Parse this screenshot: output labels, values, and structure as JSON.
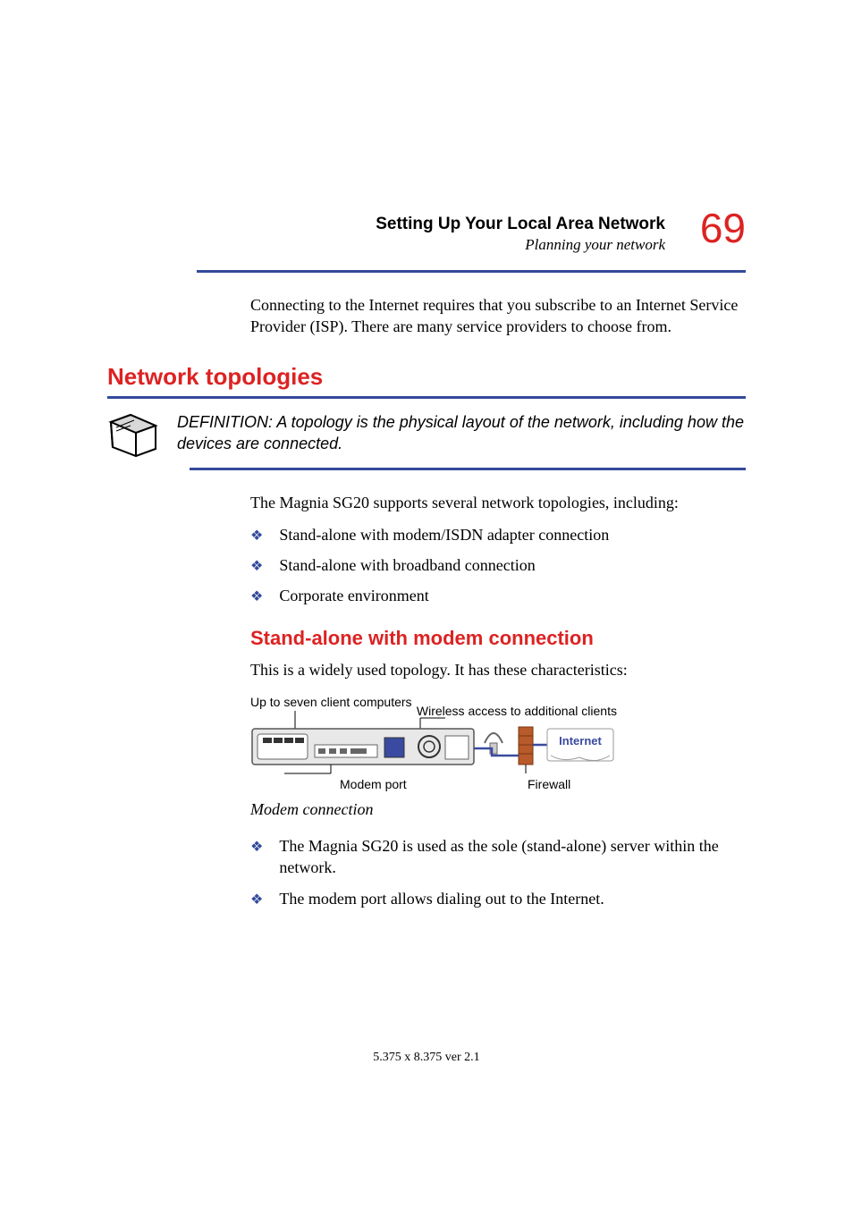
{
  "header": {
    "title": "Setting Up Your Local Area Network",
    "subtitle": "Planning your network",
    "page_number": "69"
  },
  "intro_para": "Connecting to the Internet requires that you subscribe to an Internet Service Provider (ISP). There are many service providers to choose from.",
  "h1": "Network topologies",
  "definition": "DEFINITION: A topology is the physical layout of the network, including how the devices are connected.",
  "supports_para": "The Magnia SG20 supports several network topologies, including:",
  "topology_list": [
    "Stand-alone with modem/ISDN adapter connection",
    "Stand-alone with broadband connection",
    "Corporate environment"
  ],
  "h2": "Stand-alone with modem connection",
  "h2_intro": "This is a widely used topology. It has these characteristics:",
  "diagram": {
    "label_top_left": "Up to seven client computers",
    "label_top_right": "Wireless access to additional clients",
    "label_bottom_modem": "Modem port",
    "label_bottom_firewall": "Firewall",
    "internet": "Internet"
  },
  "caption": "Modem connection",
  "char_list": [
    "The Magnia SG20 is used as the sole (stand-alone) server within the network.",
    "The modem port allows dialing out to the Internet."
  ],
  "footer": "5.375 x 8.375 ver 2.1"
}
